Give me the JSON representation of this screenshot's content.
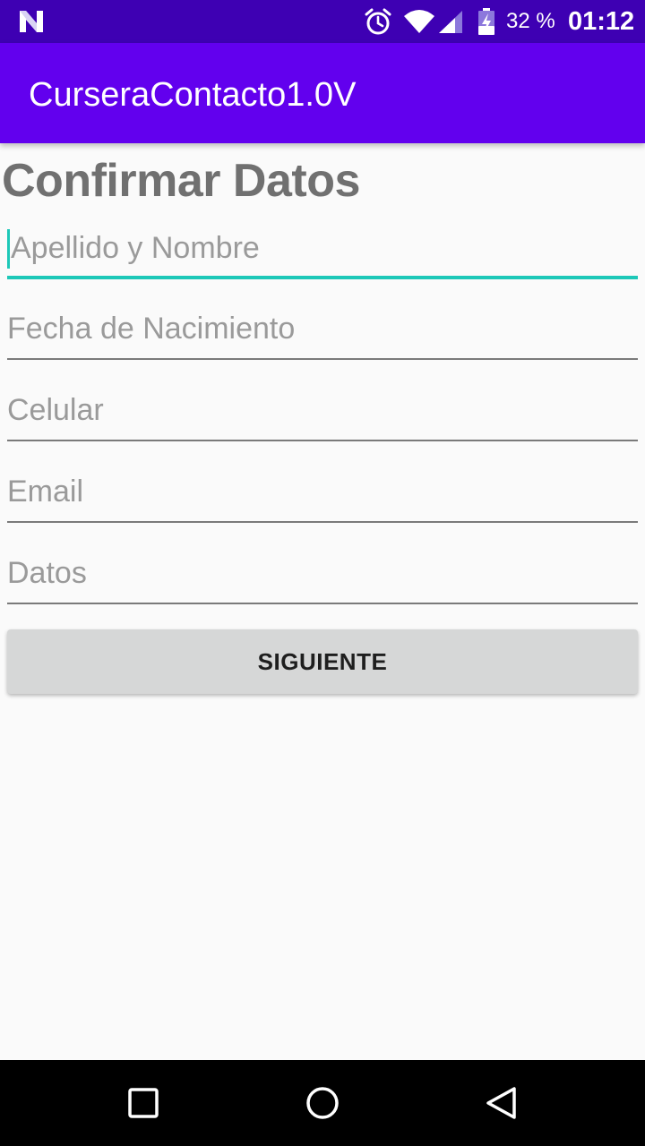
{
  "status_bar": {
    "notification_icon": "n-logo-icon",
    "icons": [
      "alarm-icon",
      "wifi-icon",
      "cell-signal-icon",
      "battery-charging-icon"
    ],
    "battery_percent": "32 %",
    "time": "01:12"
  },
  "app_bar": {
    "title": "CurseraContacto1.0V"
  },
  "form": {
    "title": "Confirmar Datos",
    "fields": [
      {
        "placeholder": "Apellido y Nombre",
        "focused": true
      },
      {
        "placeholder": "Fecha de Nacimiento",
        "focused": false
      },
      {
        "placeholder": "Celular",
        "focused": false
      },
      {
        "placeholder": "Email",
        "focused": false
      },
      {
        "placeholder": "Datos",
        "focused": false
      }
    ],
    "next_button": "SIGUIENTE"
  },
  "nav_bar": {
    "buttons": [
      "recents-icon",
      "home-icon",
      "back-icon"
    ]
  },
  "colors": {
    "status_bar": "#3e00b3",
    "app_bar": "#6200ee",
    "accent": "#1dc8b8",
    "background": "#fafafa",
    "button": "#d6d7d7"
  }
}
